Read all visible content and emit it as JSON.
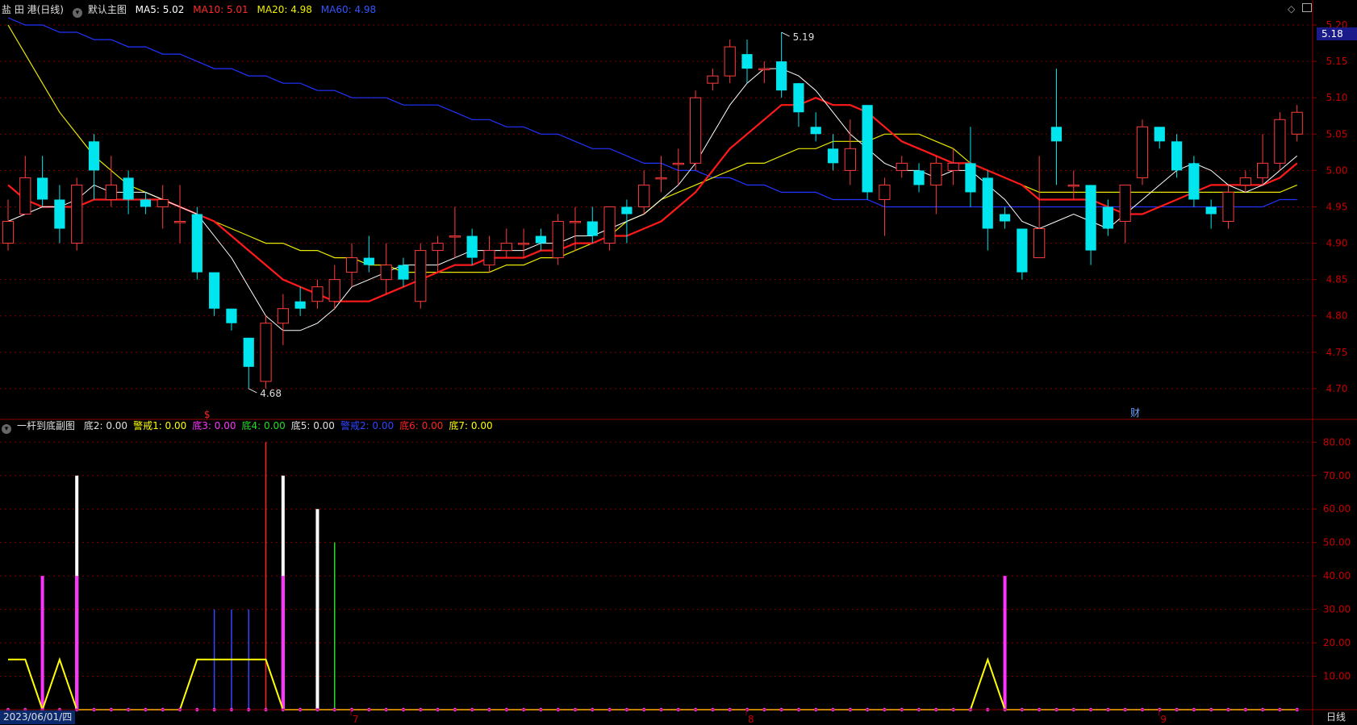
{
  "main_header": {
    "stock": "盐 田 港(日线)",
    "indicator": "默认主图",
    "ma5": "MA5: 5.02",
    "ma10": "MA10: 5.01",
    "ma20": "MA20: 4.98",
    "ma60": "MA60: 4.98"
  },
  "sub_header": {
    "indicator": "一杆到底副图",
    "items": [
      {
        "text": "底2: 0.00",
        "color": "#e0e0e0"
      },
      {
        "text": "警戒1: 0.00",
        "color": "#ffff00"
      },
      {
        "text": "底3: 0.00",
        "color": "#ff33ff"
      },
      {
        "text": "底4: 0.00",
        "color": "#22dd22"
      },
      {
        "text": "底5: 0.00",
        "color": "#e0e0e0"
      },
      {
        "text": "警戒2: 0.00",
        "color": "#3344ff"
      },
      {
        "text": "底6: 0.00",
        "color": "#ff2222"
      },
      {
        "text": "底7: 0.00",
        "color": "#ffff00"
      }
    ]
  },
  "colors": {
    "up": "#ff3b3b",
    "down": "#00e5ee",
    "ma5": "#ffffff",
    "ma10": "#ff1a1a",
    "ma20": "#e8e800",
    "ma60": "#2233ff",
    "grid": "#7a0000",
    "axis_text": "#c80000",
    "sub_axis_text": "#c80000"
  },
  "current_price_badge": "5.18",
  "high_label": "5.19",
  "low_label": "4.68",
  "event_marks": {
    "s": "$",
    "cai": "财"
  },
  "date_label": "2023/06/01/四",
  "period_label": "日线",
  "month_labels": [
    "7",
    "8",
    "9"
  ],
  "chart_data": [
    {
      "type": "candlestick",
      "ylim": [
        4.66,
        5.21
      ],
      "y_ticks": [
        "5.20",
        "5.15",
        "5.10",
        "5.05",
        "5.00",
        "4.95",
        "4.90",
        "4.85",
        "4.80",
        "4.75",
        "4.70"
      ],
      "candles": [
        [
          4.9,
          4.93,
          4.89,
          4.96
        ],
        [
          4.94,
          4.99,
          4.94,
          5.02
        ],
        [
          4.99,
          4.96,
          4.95,
          5.02
        ],
        [
          4.96,
          4.92,
          4.9,
          4.98
        ],
        [
          4.9,
          4.98,
          4.89,
          4.99
        ],
        [
          5.04,
          5.0,
          4.96,
          5.05
        ],
        [
          4.96,
          4.98,
          4.95,
          5.02
        ],
        [
          4.99,
          4.96,
          4.94,
          5.0
        ],
        [
          4.96,
          4.95,
          4.94,
          4.97
        ],
        [
          4.95,
          4.96,
          4.92,
          4.98
        ],
        [
          4.93,
          4.93,
          4.9,
          4.98
        ],
        [
          4.94,
          4.86,
          4.85,
          4.95
        ],
        [
          4.86,
          4.81,
          4.8,
          4.86
        ],
        [
          4.81,
          4.79,
          4.78,
          4.81
        ],
        [
          4.77,
          4.73,
          4.7,
          4.77
        ],
        [
          4.71,
          4.79,
          4.7,
          4.8
        ],
        [
          4.79,
          4.81,
          4.76,
          4.83
        ],
        [
          4.82,
          4.81,
          4.8,
          4.84
        ],
        [
          4.82,
          4.84,
          4.81,
          4.85
        ],
        [
          4.82,
          4.85,
          4.81,
          4.87
        ],
        [
          4.86,
          4.88,
          4.84,
          4.9
        ],
        [
          4.88,
          4.87,
          4.86,
          4.91
        ],
        [
          4.85,
          4.87,
          4.83,
          4.9
        ],
        [
          4.87,
          4.85,
          4.84,
          4.88
        ],
        [
          4.82,
          4.89,
          4.81,
          4.9
        ],
        [
          4.89,
          4.9,
          4.86,
          4.91
        ],
        [
          4.91,
          4.91,
          4.88,
          4.95
        ],
        [
          4.91,
          4.88,
          4.87,
          4.92
        ],
        [
          4.87,
          4.89,
          4.86,
          4.91
        ],
        [
          4.89,
          4.9,
          4.88,
          4.92
        ],
        [
          4.9,
          4.9,
          4.88,
          4.92
        ],
        [
          4.91,
          4.9,
          4.89,
          4.92
        ],
        [
          4.88,
          4.93,
          4.87,
          4.94
        ],
        [
          4.93,
          4.93,
          4.89,
          4.95
        ],
        [
          4.93,
          4.91,
          4.9,
          4.95
        ],
        [
          4.9,
          4.95,
          4.89,
          4.95
        ],
        [
          4.95,
          4.94,
          4.9,
          4.96
        ],
        [
          4.95,
          4.98,
          4.94,
          5.0
        ],
        [
          4.99,
          4.99,
          4.97,
          5.02
        ],
        [
          5.01,
          5.01,
          4.98,
          5.03
        ],
        [
          5.01,
          5.1,
          5.0,
          5.11
        ],
        [
          5.12,
          5.13,
          5.11,
          5.14
        ],
        [
          5.13,
          5.17,
          5.12,
          5.18
        ],
        [
          5.16,
          5.14,
          5.12,
          5.18
        ],
        [
          5.14,
          5.14,
          5.12,
          5.15
        ],
        [
          5.15,
          5.11,
          5.1,
          5.19
        ],
        [
          5.12,
          5.08,
          5.06,
          5.12
        ],
        [
          5.06,
          5.05,
          5.04,
          5.08
        ],
        [
          5.03,
          5.01,
          5.0,
          5.05
        ],
        [
          5.0,
          5.03,
          4.98,
          5.07
        ],
        [
          5.09,
          4.97,
          4.96,
          5.09
        ],
        [
          4.96,
          4.98,
          4.91,
          4.99
        ],
        [
          5.0,
          5.01,
          4.99,
          5.02
        ],
        [
          5.0,
          4.98,
          4.97,
          5.01
        ],
        [
          4.98,
          5.01,
          4.94,
          5.02
        ],
        [
          5.0,
          5.01,
          4.98,
          5.03
        ],
        [
          5.01,
          4.97,
          4.95,
          5.06
        ],
        [
          4.99,
          4.92,
          4.89,
          5.0
        ],
        [
          4.94,
          4.93,
          4.92,
          4.95
        ],
        [
          4.92,
          4.86,
          4.85,
          4.92
        ],
        [
          4.88,
          4.92,
          4.88,
          5.02
        ],
        [
          5.06,
          5.04,
          4.98,
          5.14
        ],
        [
          4.98,
          4.98,
          4.96,
          5.0
        ],
        [
          4.98,
          4.89,
          4.87,
          4.98
        ],
        [
          4.95,
          4.92,
          4.91,
          4.96
        ],
        [
          4.93,
          4.98,
          4.9,
          4.98
        ],
        [
          4.99,
          5.06,
          4.98,
          5.07
        ],
        [
          5.06,
          5.04,
          5.03,
          5.06
        ],
        [
          5.04,
          5.0,
          4.99,
          5.05
        ],
        [
          5.01,
          4.96,
          4.95,
          5.02
        ],
        [
          4.95,
          4.94,
          4.92,
          4.96
        ],
        [
          4.93,
          4.97,
          4.92,
          4.98
        ],
        [
          4.98,
          4.99,
          4.97,
          5.0
        ],
        [
          4.99,
          5.01,
          4.98,
          5.05
        ],
        [
          5.01,
          5.07,
          5.0,
          5.08
        ],
        [
          5.05,
          5.08,
          5.04,
          5.09
        ]
      ],
      "ma5": [
        4.93,
        4.94,
        4.95,
        4.95,
        4.96,
        4.98,
        4.97,
        4.97,
        4.97,
        4.96,
        4.95,
        4.94,
        4.91,
        4.88,
        4.84,
        4.8,
        4.78,
        4.78,
        4.79,
        4.81,
        4.84,
        4.85,
        4.86,
        4.87,
        4.87,
        4.87,
        4.88,
        4.89,
        4.89,
        4.89,
        4.89,
        4.9,
        4.9,
        4.91,
        4.91,
        4.92,
        4.93,
        4.94,
        4.96,
        4.98,
        5.01,
        5.05,
        5.09,
        5.12,
        5.14,
        5.14,
        5.13,
        5.11,
        5.08,
        5.05,
        5.03,
        5.01,
        5.0,
        5.0,
        4.99,
        5.0,
        5.0,
        4.98,
        4.96,
        4.93,
        4.92,
        4.93,
        4.94,
        4.93,
        4.92,
        4.94,
        4.96,
        4.98,
        5.0,
        5.01,
        5.0,
        4.98,
        4.97,
        4.98,
        5.0,
        5.02
      ],
      "ma10": [
        4.98,
        4.96,
        4.95,
        4.95,
        4.95,
        4.96,
        4.96,
        4.96,
        4.96,
        4.96,
        4.95,
        4.94,
        4.93,
        4.91,
        4.89,
        4.87,
        4.85,
        4.84,
        4.83,
        4.82,
        4.82,
        4.82,
        4.83,
        4.84,
        4.85,
        4.86,
        4.87,
        4.87,
        4.88,
        4.88,
        4.88,
        4.89,
        4.89,
        4.9,
        4.9,
        4.91,
        4.91,
        4.92,
        4.93,
        4.95,
        4.97,
        5.0,
        5.03,
        5.05,
        5.07,
        5.09,
        5.09,
        5.1,
        5.09,
        5.09,
        5.08,
        5.06,
        5.04,
        5.03,
        5.02,
        5.01,
        5.01,
        5.0,
        4.99,
        4.98,
        4.96,
        4.96,
        4.96,
        4.96,
        4.95,
        4.94,
        4.94,
        4.95,
        4.96,
        4.97,
        4.98,
        4.98,
        4.98,
        4.98,
        4.99,
        5.01
      ],
      "ma20": [
        5.2,
        5.16,
        5.12,
        5.08,
        5.05,
        5.02,
        5.0,
        4.98,
        4.97,
        4.96,
        4.95,
        4.94,
        4.93,
        4.92,
        4.91,
        4.9,
        4.9,
        4.89,
        4.89,
        4.88,
        4.88,
        4.87,
        4.87,
        4.86,
        4.86,
        4.86,
        4.86,
        4.86,
        4.86,
        4.87,
        4.87,
        4.88,
        4.88,
        4.89,
        4.9,
        4.91,
        4.93,
        4.94,
        4.96,
        4.97,
        4.98,
        4.99,
        5.0,
        5.01,
        5.01,
        5.02,
        5.03,
        5.03,
        5.04,
        5.04,
        5.04,
        5.05,
        5.05,
        5.05,
        5.04,
        5.03,
        5.01,
        5.0,
        4.99,
        4.98,
        4.97,
        4.97,
        4.97,
        4.97,
        4.97,
        4.97,
        4.97,
        4.97,
        4.97,
        4.97,
        4.97,
        4.97,
        4.97,
        4.97,
        4.97,
        4.98
      ],
      "ma60": [
        5.21,
        5.2,
        5.2,
        5.19,
        5.19,
        5.18,
        5.18,
        5.17,
        5.17,
        5.16,
        5.16,
        5.15,
        5.14,
        5.14,
        5.13,
        5.13,
        5.12,
        5.12,
        5.11,
        5.11,
        5.1,
        5.1,
        5.1,
        5.09,
        5.09,
        5.09,
        5.08,
        5.07,
        5.07,
        5.06,
        5.06,
        5.05,
        5.05,
        5.04,
        5.03,
        5.03,
        5.02,
        5.01,
        5.01,
        5.0,
        5.0,
        4.99,
        4.99,
        4.98,
        4.98,
        4.97,
        4.97,
        4.97,
        4.96,
        4.96,
        4.96,
        4.95,
        4.95,
        4.95,
        4.95,
        4.95,
        4.95,
        4.95,
        4.95,
        4.95,
        4.95,
        4.95,
        4.95,
        4.95,
        4.95,
        4.95,
        4.95,
        4.95,
        4.95,
        4.95,
        4.95,
        4.95,
        4.95,
        4.95,
        4.96,
        4.96
      ]
    },
    {
      "type": "bar",
      "ylim": [
        0,
        82
      ],
      "y_ticks": [
        "80.00",
        "70.00",
        "60.00",
        "50.00",
        "40.00",
        "30.00",
        "20.00",
        "10.00"
      ],
      "yellow_line": [
        15,
        15,
        0,
        15,
        0,
        0,
        0,
        0,
        0,
        0,
        0,
        15,
        15,
        15,
        15,
        15,
        0,
        0,
        0,
        0,
        0,
        0,
        0,
        0,
        0,
        0,
        0,
        0,
        0,
        0,
        0,
        0,
        0,
        0,
        0,
        0,
        0,
        0,
        0,
        0,
        0,
        0,
        0,
        0,
        0,
        0,
        0,
        0,
        0,
        0,
        0,
        0,
        0,
        0,
        0,
        0,
        0,
        15,
        0,
        0,
        0,
        0,
        0,
        0,
        0,
        0,
        0,
        0,
        0,
        0,
        0,
        0,
        0,
        0,
        0,
        0
      ],
      "bars": [
        {
          "i": 2,
          "v": 40,
          "color": "#ff33ff"
        },
        {
          "i": 4,
          "v": 70,
          "color": "#ffffff"
        },
        {
          "i": 4,
          "v": 40,
          "color": "#ff33ff"
        },
        {
          "i": 12,
          "v": 30,
          "color": "#3344ff"
        },
        {
          "i": 13,
          "v": 30,
          "color": "#3344ff"
        },
        {
          "i": 14,
          "v": 30,
          "color": "#3344ff"
        },
        {
          "i": 15,
          "v": 80,
          "color": "#ff2222"
        },
        {
          "i": 16,
          "v": 70,
          "color": "#ffffff"
        },
        {
          "i": 16,
          "v": 40,
          "color": "#ff33ff"
        },
        {
          "i": 18,
          "v": 60,
          "color": "#ffffff"
        },
        {
          "i": 19,
          "v": 50,
          "color": "#22dd22"
        },
        {
          "i": 58,
          "v": 40,
          "color": "#ff33ff"
        }
      ]
    }
  ]
}
